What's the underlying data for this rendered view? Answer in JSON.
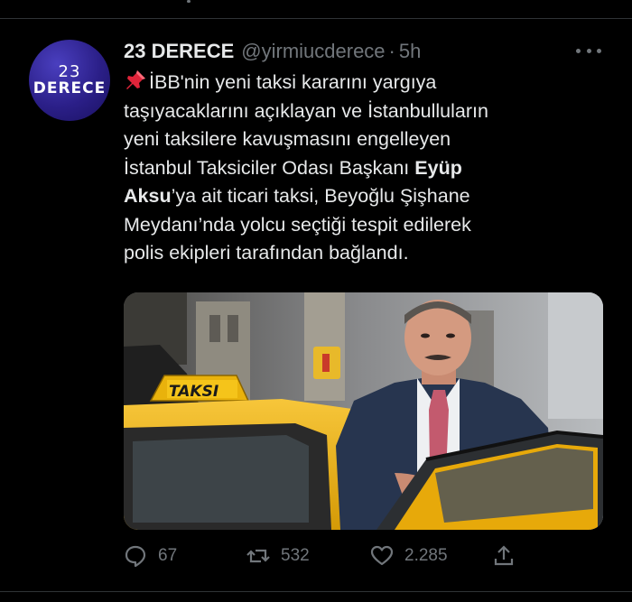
{
  "author": {
    "name": "23 DERECE",
    "handle": "@yirmiucderece",
    "separator": "·",
    "time": "5h",
    "avatar_number": "23",
    "avatar_word": "DERECE"
  },
  "tweet": {
    "line1": "İBB'nin yeni taksi kararını yargıya",
    "line2": "taşıyacaklarını açıklayan ve İstanbulluların",
    "line3": "yeni taksilere kavuşmasını engelleyen",
    "line4_before": "İstanbul Taksiciler Odası Başkanı ",
    "line4_bold": "Eyüp",
    "line5_bold": "Aksu",
    "line5_after": "’ya ait ticari taksi, Beyoğlu Şişhane",
    "line6": "Meydanı’nda yolcu seçtiği tespit edilerek",
    "line7": "polis ekipleri tarafından bağlandı."
  },
  "media": {
    "taxi_sign": "TAKSI"
  },
  "actions": {
    "reply_count": "67",
    "retweet_count": "532",
    "like_count": "2.285"
  },
  "colors": {
    "background": "#000000",
    "text": "#e7e9ea",
    "secondary": "#71767b",
    "avatar": "#2b1f88",
    "taxi_yellow": "#f2b705"
  }
}
